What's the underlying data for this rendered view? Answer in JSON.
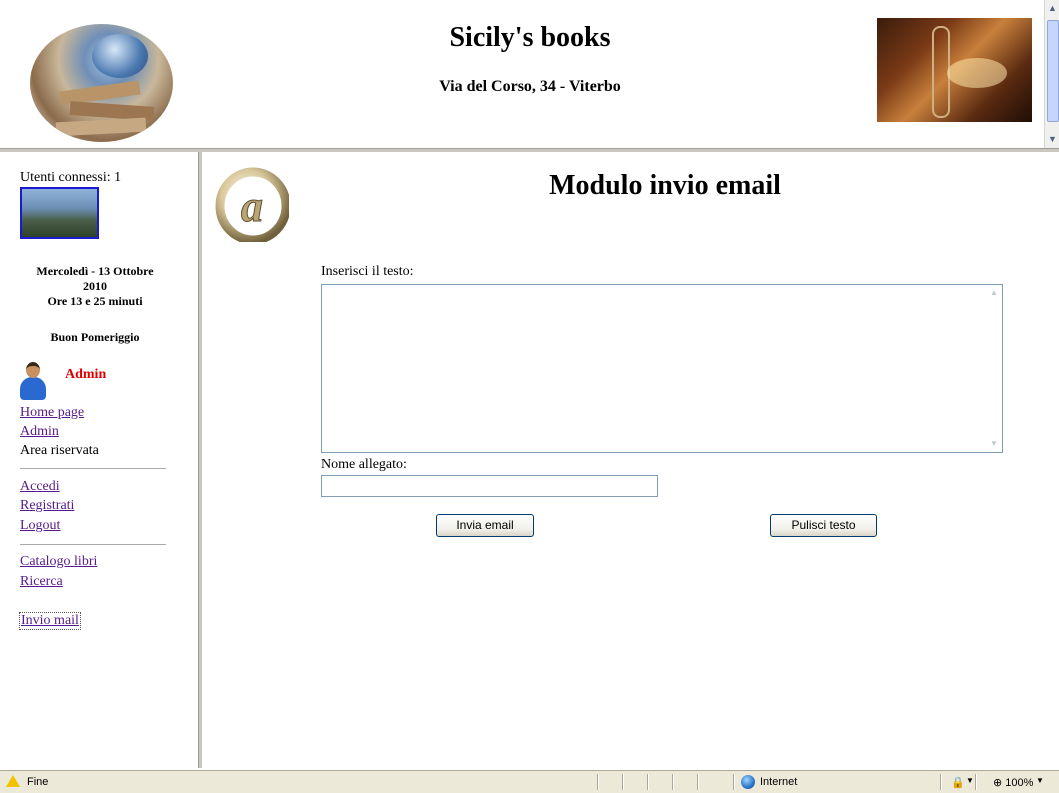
{
  "header": {
    "title": "Sicily's books",
    "address": "Via del Corso, 34 - Viterbo"
  },
  "sidebar": {
    "users_connected": "Utenti connessi: 1",
    "date_line1": "Mercoledì - 13 Ottobre",
    "date_line2": "2010",
    "date_line3": "Ore 13 e 25 minuti",
    "greeting": "Buon Pomeriggio",
    "user_name": "Admin",
    "links_group1": [
      {
        "label": "Home page",
        "link": true
      },
      {
        "label": "Admin",
        "link": true
      },
      {
        "label": "Area riservata",
        "link": false
      }
    ],
    "links_group2": [
      {
        "label": "Accedi"
      },
      {
        "label": "Registrati"
      },
      {
        "label": "Logout"
      }
    ],
    "links_group3": [
      {
        "label": "Catalogo libri"
      },
      {
        "label": "Ricerca"
      }
    ],
    "active_link": "Invio mail"
  },
  "main": {
    "page_title": "Modulo invio email",
    "text_label": "Inserisci il testo:",
    "text_value": "",
    "attachment_label": "Nome allegato:",
    "attachment_value": "",
    "send_button": "Invia email",
    "clear_button": "Pulisci testo"
  },
  "statusbar": {
    "status": "Fine",
    "zone": "Internet",
    "zoom": "100%"
  },
  "colors": {
    "admin_name": "#e00000",
    "visited_link": "#551a8b",
    "input_border": "#7f9db9",
    "statusbar_bg": "#ece9d8"
  },
  "icons": [
    "logo-books-globe",
    "library-photo",
    "user-avatar-icon",
    "at-sign-icon",
    "warning-icon",
    "globe-icon",
    "lock-icon",
    "zoom-icon"
  ]
}
